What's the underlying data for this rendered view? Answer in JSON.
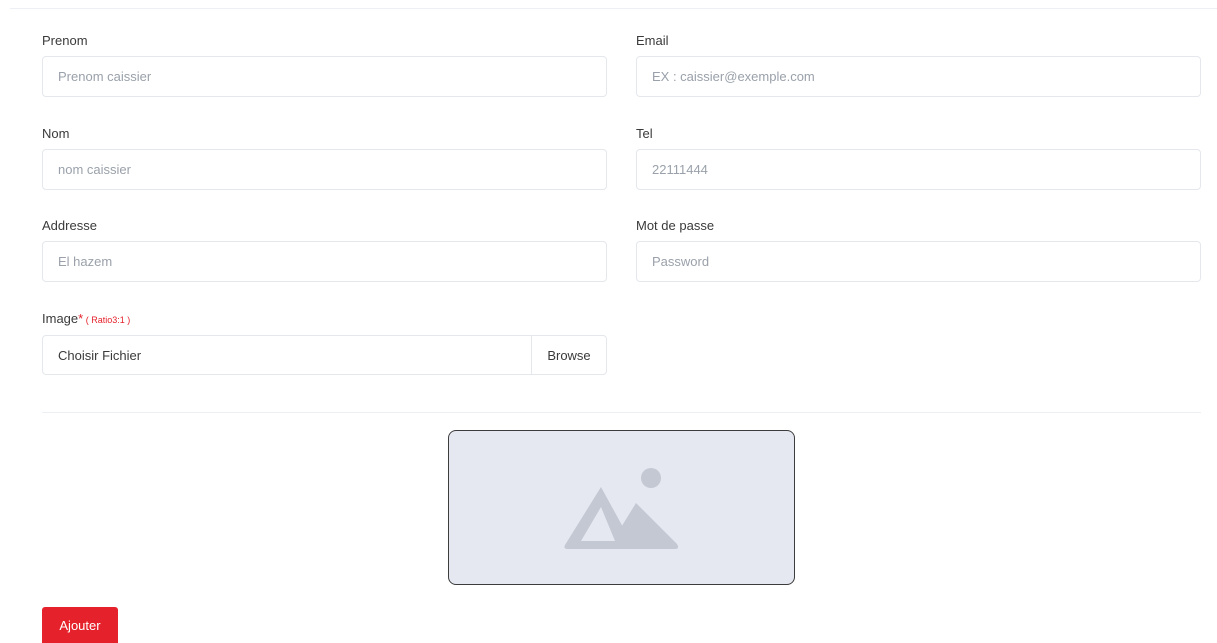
{
  "form": {
    "prenom": {
      "label": "Prenom",
      "placeholder": "Prenom caissier"
    },
    "email": {
      "label": "Email",
      "placeholder": "EX : caissier@exemple.com"
    },
    "nom": {
      "label": "Nom",
      "placeholder": "nom caissier"
    },
    "tel": {
      "label": "Tel",
      "placeholder": "22111444"
    },
    "adresse": {
      "label": "Addresse",
      "placeholder": "El hazem"
    },
    "password": {
      "label": "Mot de passe",
      "placeholder": "Password"
    },
    "image": {
      "label": "Image",
      "required_mark": "*",
      "hint": " ( Ratio3:1 )",
      "file_text": "Choisir Fichier",
      "browse_label": "Browse"
    },
    "submit_label": "Ajouter"
  },
  "icons": {
    "preview": "image-placeholder-icon"
  },
  "colors": {
    "accent": "#e5222b",
    "preview_bg": "#e6e8f1",
    "placeholder_icon": "#c3c8d2"
  }
}
